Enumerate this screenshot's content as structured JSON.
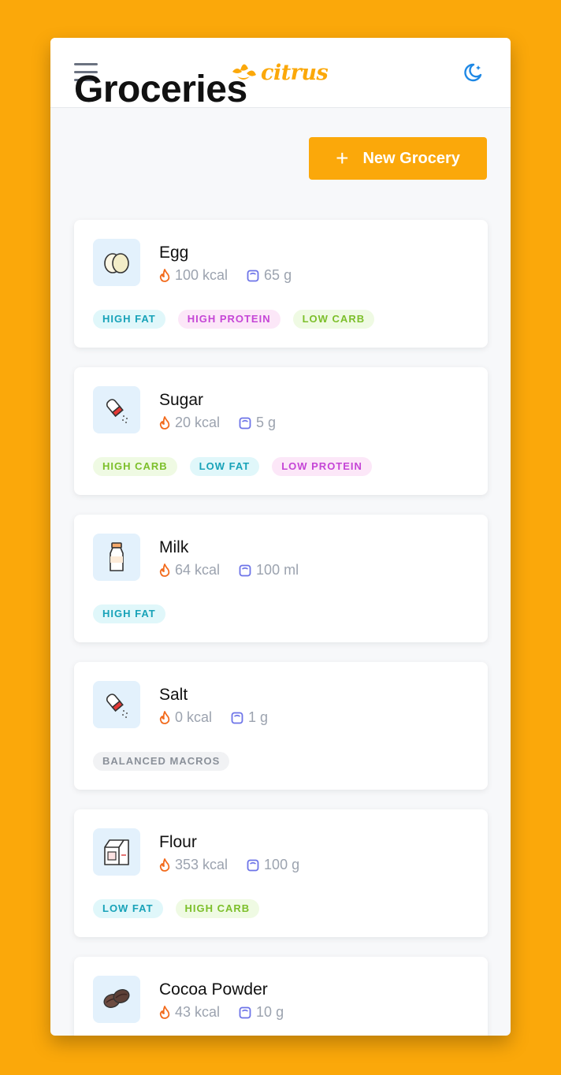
{
  "app": {
    "logo_text": "citrus"
  },
  "header": {
    "menu_icon": "hamburger-menu-icon",
    "theme_icon": "moon-stars-icon"
  },
  "page": {
    "title": "Groceries",
    "new_button_label": "New Grocery",
    "new_button_icon": "+"
  },
  "colors": {
    "brand": "#FBA80A",
    "teal": "#17A2B8",
    "pink": "#C545D6",
    "green": "#7CBF2A",
    "gray": "#8A9099",
    "flame": "#F26B1D",
    "scale": "#6D74E8"
  },
  "groceries": [
    {
      "name": "Egg",
      "icon": "egg-icon",
      "kcal": "100 kcal",
      "amount": "65 g",
      "tags": [
        {
          "label": "HIGH FAT",
          "color": "teal"
        },
        {
          "label": "HIGH PROTEIN",
          "color": "pink"
        },
        {
          "label": "LOW CARB",
          "color": "green"
        }
      ]
    },
    {
      "name": "Sugar",
      "icon": "shaker-icon",
      "kcal": "20 kcal",
      "amount": "5 g",
      "tags": [
        {
          "label": "HIGH CARB",
          "color": "green"
        },
        {
          "label": "LOW FAT",
          "color": "teal"
        },
        {
          "label": "LOW PROTEIN",
          "color": "pink"
        }
      ]
    },
    {
      "name": "Milk",
      "icon": "milk-bottle-icon",
      "kcal": "64 kcal",
      "amount": "100 ml",
      "tags": [
        {
          "label": "HIGH FAT",
          "color": "teal"
        }
      ]
    },
    {
      "name": "Salt",
      "icon": "shaker-icon",
      "kcal": "0 kcal",
      "amount": "1 g",
      "tags": [
        {
          "label": "BALANCED MACROS",
          "color": "gray"
        }
      ]
    },
    {
      "name": "Flour",
      "icon": "flour-bag-icon",
      "kcal": "353 kcal",
      "amount": "100 g",
      "tags": [
        {
          "label": "LOW FAT",
          "color": "teal"
        },
        {
          "label": "HIGH CARB",
          "color": "green"
        }
      ]
    },
    {
      "name": "Cocoa Powder",
      "icon": "cocoa-beans-icon",
      "kcal": "43 kcal",
      "amount": "10 g",
      "tags": []
    }
  ]
}
